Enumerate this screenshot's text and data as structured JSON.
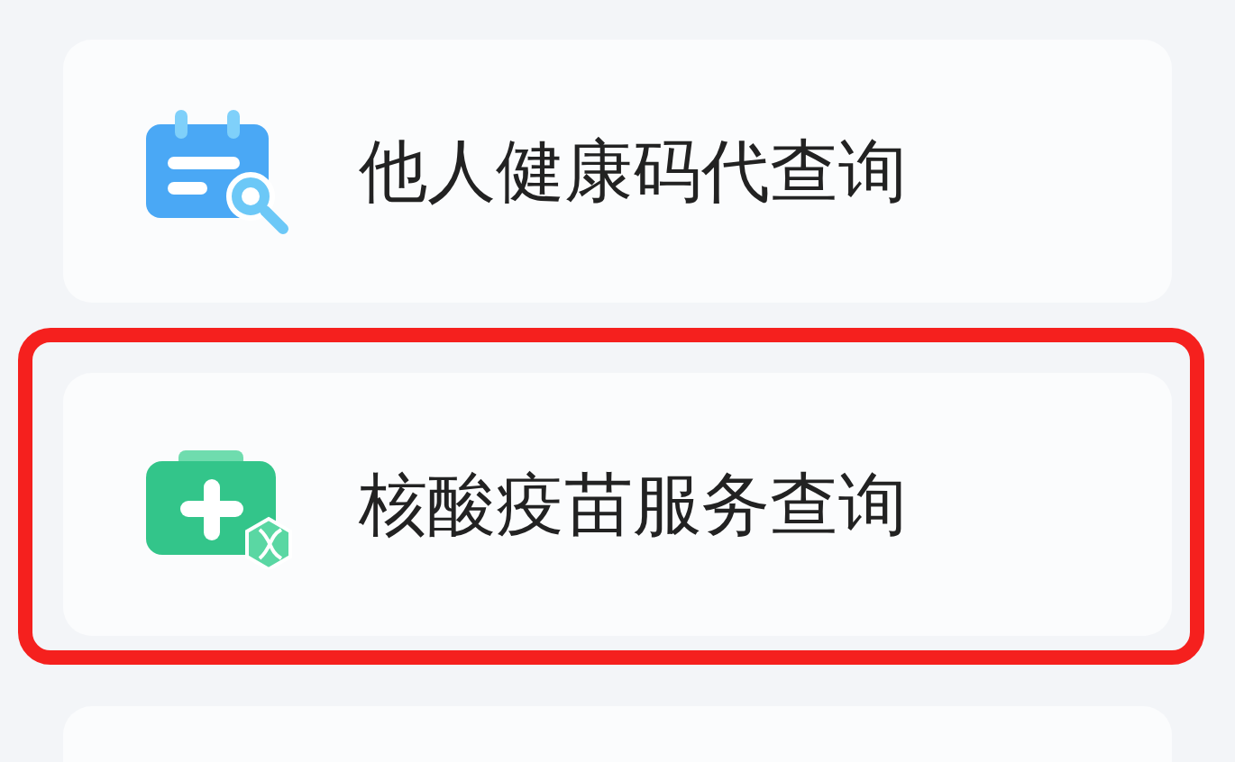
{
  "menu_items": [
    {
      "label": "他人健康码代查询",
      "kind": "calendar-search",
      "highlighted": false
    },
    {
      "label": "核酸疫苗服务查询",
      "kind": "medical-kit",
      "highlighted": true
    },
    {
      "kind": "none",
      "highlighted": false
    }
  ]
}
